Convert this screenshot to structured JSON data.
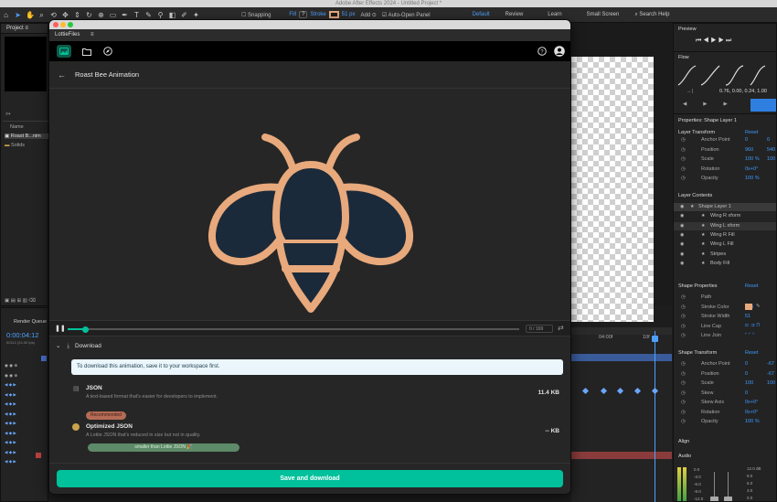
{
  "app": {
    "window_title": "Adobe After Effects 2024 - Untitled Project *"
  },
  "toolbar": {
    "snapping_label": "Snapping",
    "fill_label": "Fill",
    "stroke_label": "Stroke",
    "stroke_value": "51 px",
    "add_label": "Add",
    "auto_open_label": "Auto-Open Panel",
    "workspaces": [
      "Default",
      "Review",
      "Learn",
      "Small Screen"
    ],
    "search_placeholder": "Search Help"
  },
  "project_panel": {
    "title": "Project",
    "col_name": "Name",
    "items": [
      "Roast B...nim",
      "Solids"
    ]
  },
  "render_queue": {
    "title": "Render Queue",
    "timecode": "0:00:04:12",
    "timecode_sub": "00112 (24.00 fps)"
  },
  "preview_panel": {
    "title": "Preview"
  },
  "flow_panel": {
    "title": "Flow",
    "bezier_values": "0.76, 0.00, 0.24, 1.00"
  },
  "properties_panel": {
    "title": "Properties: Shape Layer 1",
    "layer_transform": {
      "title": "Layer Transform",
      "reset": "Reset",
      "rows": [
        {
          "label": "Anchor Point",
          "v1": "0",
          "v2": "0"
        },
        {
          "label": "Position",
          "v1": "960",
          "v2": "540"
        },
        {
          "label": "Scale",
          "v1": "100 %",
          "v2": "100 %"
        },
        {
          "label": "Rotation",
          "v1": "0x+0°",
          "v2": ""
        },
        {
          "label": "Opacity",
          "v1": "100 %",
          "v2": ""
        }
      ]
    },
    "layer_contents": {
      "title": "Layer Contents",
      "items": [
        "Shape Layer 1",
        "Wing R xform",
        "Wing L xform",
        "Wing R Fill",
        "Wing L Fill",
        "Stripes",
        "Body Fill"
      ]
    },
    "shape_properties": {
      "title": "Shape Properties",
      "reset": "Reset",
      "rows": [
        {
          "label": "Path",
          "v1": ""
        },
        {
          "label": "Stroke Color",
          "v1": "Soli"
        },
        {
          "label": "Stroke Width",
          "v1": "51"
        },
        {
          "label": "Line Cap",
          "v1": ""
        },
        {
          "label": "Line Join",
          "v1": ""
        }
      ]
    },
    "shape_transform": {
      "title": "Shape Transform",
      "reset": "Reset",
      "rows": [
        {
          "label": "Anchor Point",
          "v1": "0",
          "v2": "-67"
        },
        {
          "label": "Position",
          "v1": "0",
          "v2": "-67"
        },
        {
          "label": "Scale",
          "v1": "100",
          "v2": "100"
        },
        {
          "label": "Skew",
          "v1": "0",
          "v2": ""
        },
        {
          "label": "Skew Axis",
          "v1": "0x+0°",
          "v2": ""
        },
        {
          "label": "Rotation",
          "v1": "0x+0°",
          "v2": ""
        },
        {
          "label": "Opacity",
          "v1": "100 %",
          "v2": ""
        }
      ]
    },
    "align_title": "Align",
    "audio_title": "Audio",
    "audio_db_left": [
      "0.0",
      "-3.0",
      "-6.0",
      "-9.0",
      "-12.0"
    ],
    "audio_db_right": [
      "12.0 dB",
      "9.0",
      "6.0",
      "3.0",
      "0.0"
    ]
  },
  "timeline": {
    "marker_04": "04:00f",
    "marker_10": "10f"
  },
  "lottie": {
    "tab_label": "LottieFiles",
    "animation_title": "Roast Bee Animation",
    "player": {
      "frame_current": "0",
      "frame_total": "/ 169",
      "progress": 0.04
    },
    "download": {
      "section_title": "Download",
      "notice": "To download this animation, save it to your workspace first.",
      "formats": [
        {
          "name": "JSON",
          "desc": "A text-based format that's easier for developers to implement.",
          "size": "11.4 KB"
        },
        {
          "name": "Optimized JSON",
          "desc": "A Lottie JSON that's reduced in size but not in quality.",
          "size": "-- KB",
          "badge": "Recommended",
          "note": "smaller than Lottie JSON 🎉"
        }
      ]
    },
    "save_button": "Save and download"
  },
  "colors": {
    "accent_teal": "#00c19c",
    "bee_outline": "#e8a97c",
    "bee_body": "#1b2a3a",
    "ae_blue": "#3d9bff"
  }
}
